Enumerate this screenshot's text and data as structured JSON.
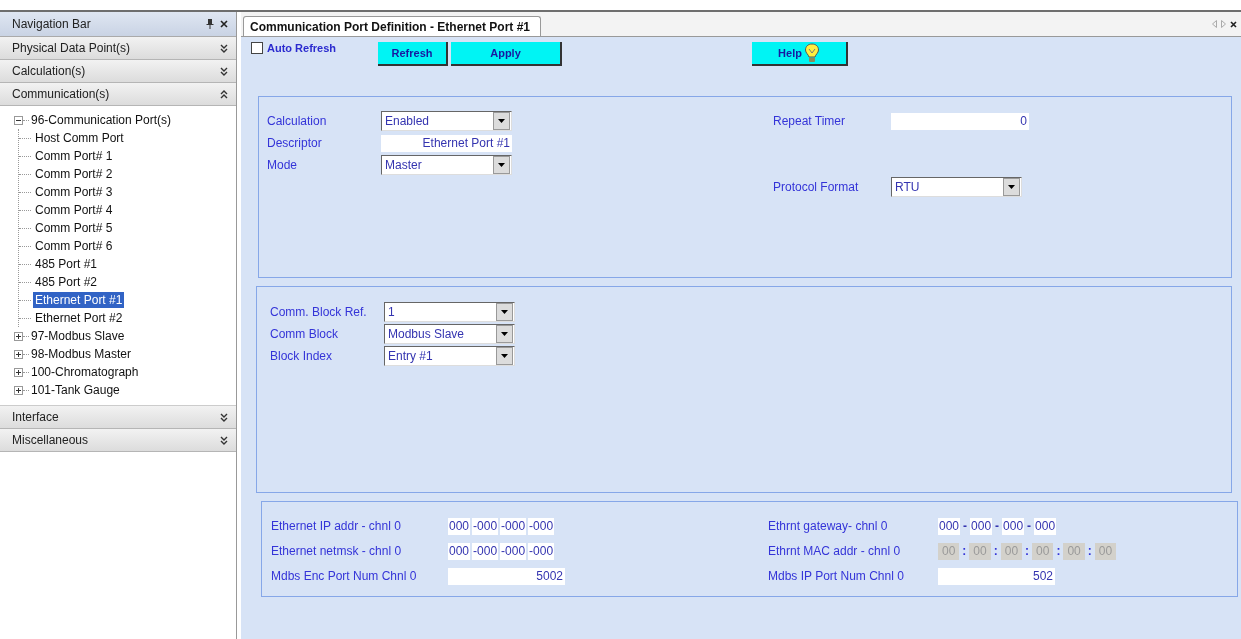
{
  "nav": {
    "title": "Navigation Bar",
    "sections": [
      {
        "label": "Physical Data Point(s)",
        "expanded": false
      },
      {
        "label": "Calculation(s)",
        "expanded": false
      },
      {
        "label": "Communication(s)",
        "expanded": true,
        "tree": [
          {
            "label": "96-Communication Port(s)",
            "expanded": true,
            "children": [
              {
                "label": "Host Comm Port",
                "selected": false
              },
              {
                "label": "Comm Port# 1",
                "selected": false
              },
              {
                "label": "Comm Port# 2",
                "selected": false
              },
              {
                "label": "Comm Port# 3",
                "selected": false
              },
              {
                "label": "Comm Port# 4",
                "selected": false
              },
              {
                "label": "Comm Port# 5",
                "selected": false
              },
              {
                "label": "Comm Port# 6",
                "selected": false
              },
              {
                "label": "485 Port #1",
                "selected": false
              },
              {
                "label": "485 Port #2",
                "selected": false
              },
              {
                "label": "Ethernet Port #1",
                "selected": true
              },
              {
                "label": "Ethernet Port #2",
                "selected": false
              }
            ]
          },
          {
            "label": "97-Modbus Slave",
            "expanded": false
          },
          {
            "label": "98-Modbus Master",
            "expanded": false
          },
          {
            "label": "100-Chromatograph",
            "expanded": false
          },
          {
            "label": "101-Tank Gauge",
            "expanded": false
          }
        ]
      },
      {
        "label": "Interface",
        "expanded": false
      },
      {
        "label": "Miscellaneous",
        "expanded": false
      }
    ]
  },
  "tab": {
    "title": "Communication Port Definition - Ethernet Port #1"
  },
  "toolbar": {
    "auto_refresh": {
      "label": "Auto Refresh",
      "checked": false
    },
    "buttons": [
      {
        "label": "Refresh",
        "kind": "plain"
      },
      {
        "label": "Apply",
        "kind": "wide"
      },
      {
        "label": "Help",
        "kind": "help"
      }
    ]
  },
  "panels": [
    {
      "left": [
        {
          "label": "Calculation",
          "kind": "dropdown",
          "value": "Enabled"
        },
        {
          "label": "Descriptor",
          "kind": "text",
          "value": "Ethernet Port #1"
        },
        {
          "label": "Mode",
          "kind": "dropdown",
          "value": "Master"
        }
      ],
      "right": [
        {
          "label": "Repeat Timer",
          "kind": "text",
          "value": "0"
        },
        {
          "label": "Protocol Format",
          "kind": "dropdown",
          "value": "RTU"
        }
      ]
    },
    {
      "left": [
        {
          "label": "Comm. Block Ref.",
          "kind": "dropdown",
          "value": "1"
        },
        {
          "label": "Comm Block",
          "kind": "dropdown",
          "value": "Modbus Slave"
        },
        {
          "label": "Block Index",
          "kind": "dropdown",
          "value": "Entry #1"
        }
      ]
    },
    {
      "left": [
        {
          "label": "Ethernet IP addr - chnl 0",
          "kind": "address",
          "disabled": false,
          "parts": [
            {
              "kind": "segment",
              "text": "000"
            },
            {
              "kind": "segment",
              "text": "-000"
            },
            {
              "kind": "segment",
              "text": "-000"
            },
            {
              "kind": "segment",
              "text": "-000"
            }
          ]
        },
        {
          "label": "Ethernet netmsk - chnl 0",
          "kind": "address",
          "disabled": false,
          "parts": [
            {
              "kind": "segment",
              "text": "000"
            },
            {
              "kind": "segment",
              "text": "-000"
            },
            {
              "kind": "segment",
              "text": "-000"
            },
            {
              "kind": "segment",
              "text": "-000"
            }
          ]
        },
        {
          "label": "Mdbs Enc Port Num Chnl 0",
          "kind": "text",
          "value": "5002"
        }
      ],
      "right": [
        {
          "label": "Ethrnt gateway- chnl 0",
          "kind": "address",
          "disabled": false,
          "parts": [
            {
              "kind": "segment",
              "text": "000"
            },
            {
              "kind": "separator",
              "text": "-"
            },
            {
              "kind": "segment",
              "text": "000"
            },
            {
              "kind": "separator",
              "text": "-"
            },
            {
              "kind": "segment",
              "text": "000"
            },
            {
              "kind": "separator",
              "text": "-"
            },
            {
              "kind": "segment",
              "text": "000"
            }
          ]
        },
        {
          "label": "Ethrnt MAC addr - chnl 0",
          "kind": "address",
          "disabled": true,
          "parts": [
            {
              "kind": "segment",
              "text": "00"
            },
            {
              "kind": "separator",
              "text": ":"
            },
            {
              "kind": "segment",
              "text": "00"
            },
            {
              "kind": "separator",
              "text": ":"
            },
            {
              "kind": "segment",
              "text": "00"
            },
            {
              "kind": "separator",
              "text": ":"
            },
            {
              "kind": "segment",
              "text": "00"
            },
            {
              "kind": "separator",
              "text": ":"
            },
            {
              "kind": "segment",
              "text": "00"
            },
            {
              "kind": "separator",
              "text": ":"
            },
            {
              "kind": "segment",
              "text": "00"
            }
          ]
        },
        {
          "label": "Mdbs IP Port Num Chnl 0",
          "kind": "text",
          "value": "502"
        }
      ]
    }
  ]
}
